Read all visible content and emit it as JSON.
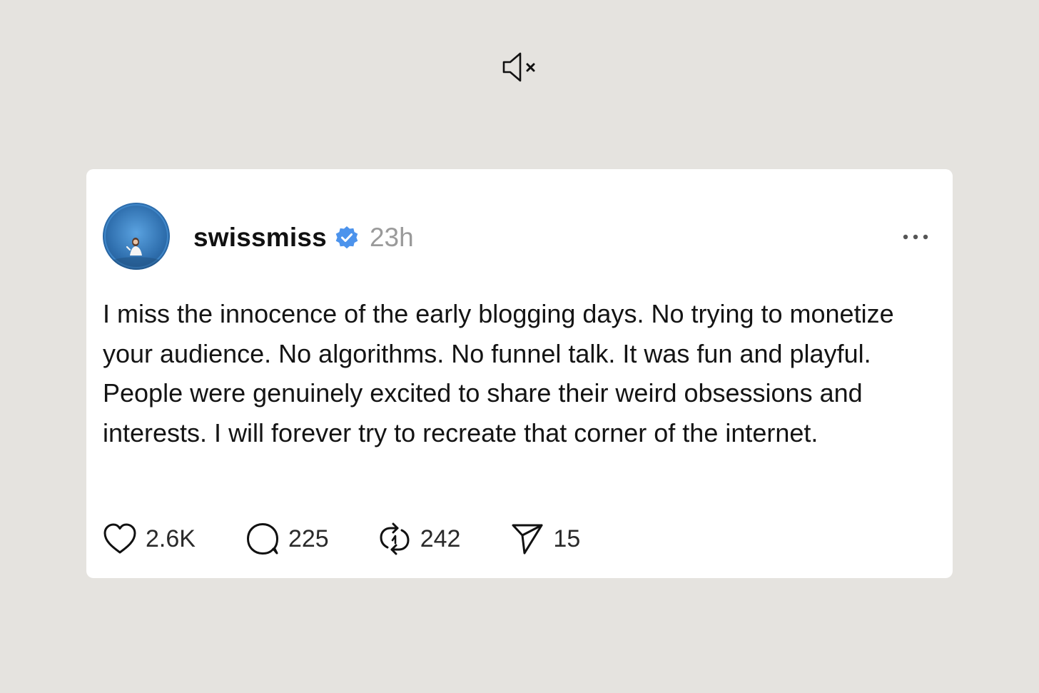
{
  "post": {
    "username": "swissmiss",
    "verified": true,
    "timestamp": "23h",
    "text": "I miss the innocence of the early blogging days. No trying to monetize your audience. No algorithms. No funnel talk. It was fun and playful. People were genuinely excited to share their weird obsessions and interests. I will forever try to recreate that corner of the internet.",
    "actions": {
      "likes": "2.6K",
      "replies": "225",
      "reposts": "242",
      "shares": "15"
    }
  },
  "icons": {
    "mute": "speaker-muted-icon",
    "verified": "verified-badge-icon",
    "more": "more-options-icon",
    "like": "heart-icon",
    "reply": "speech-bubble-icon",
    "repost": "repost-icon",
    "share": "send-icon"
  },
  "colors": {
    "background": "#e5e3df",
    "card": "#ffffff",
    "verified": "#4c93ec",
    "timestamp": "#9a9a9a",
    "text": "#141414"
  }
}
